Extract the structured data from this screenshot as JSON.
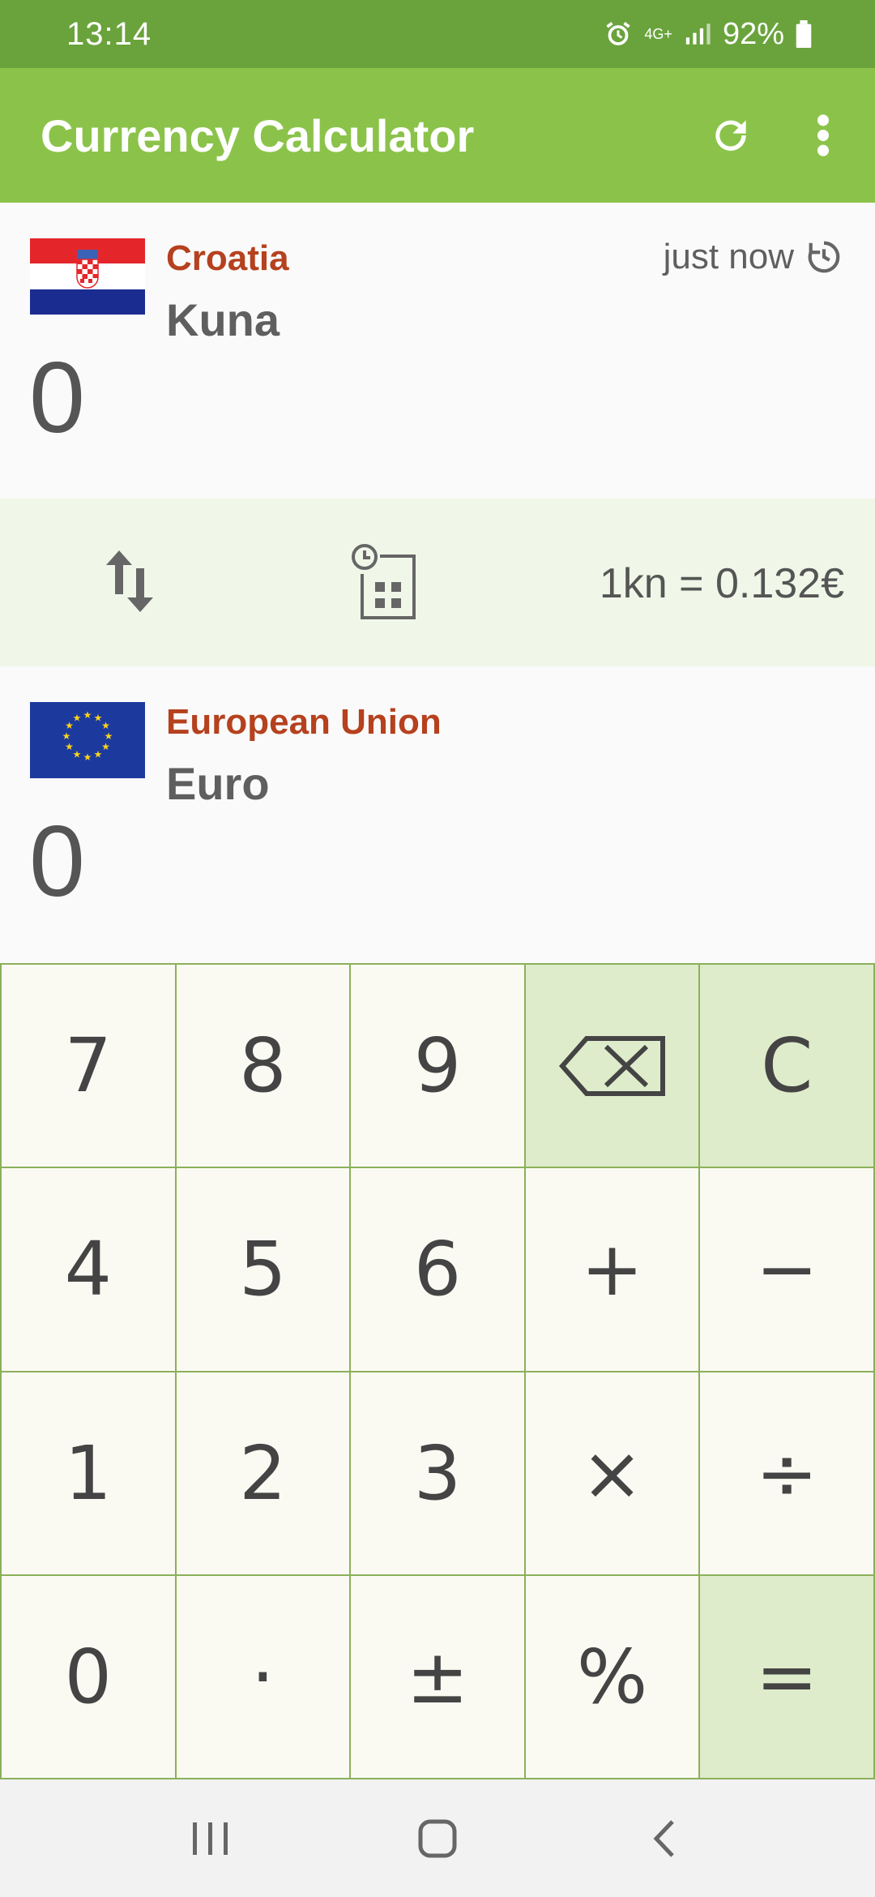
{
  "status_bar": {
    "time": "13:14",
    "network": "4G+",
    "battery": "92%"
  },
  "app_bar": {
    "title": "Currency Calculator",
    "icons": [
      "refresh-icon",
      "more-vert-icon"
    ]
  },
  "from_currency": {
    "country": "Croatia",
    "currency": "Kuna",
    "amount": "0",
    "updated": "just now",
    "flag": "croatia-flag"
  },
  "exchange_bar": {
    "rate": "1kn = 0.132€",
    "icons": [
      "swap-icon",
      "history-calculator-icon"
    ]
  },
  "to_currency": {
    "country": "European Union",
    "currency": "Euro",
    "amount": "0",
    "flag": "eu-flag"
  },
  "keypad": {
    "keys": [
      "7",
      "8",
      "9",
      "⌫",
      "C",
      "4",
      "5",
      "6",
      "+",
      "−",
      "1",
      "2",
      "3",
      "×",
      "÷",
      "0",
      "·",
      "±",
      "%",
      "="
    ]
  },
  "colors": {
    "status_bar": "#6aa33c",
    "app_bar": "#8bc34a",
    "country_text": "#b5411e",
    "accent_key": "#dfeccb",
    "key_border": "#8bb05a"
  }
}
